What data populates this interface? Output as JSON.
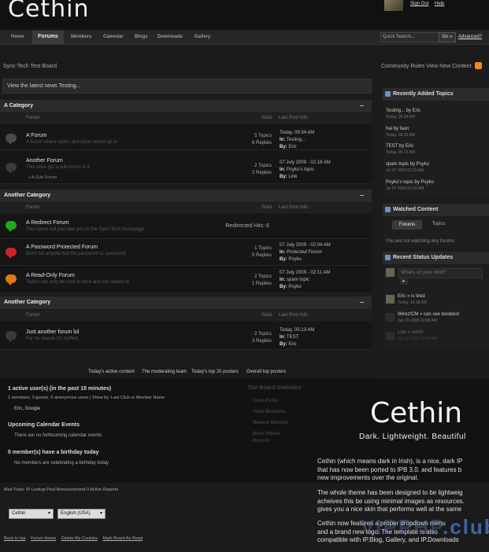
{
  "app": {
    "logo": "Cethin",
    "user_links": [
      "Sign Out",
      "Help"
    ]
  },
  "nav": {
    "tabs": [
      "Home",
      "Forums",
      "Members",
      "Calendar",
      "Blogs",
      "Downloads",
      "Gallery"
    ],
    "active": "Forums",
    "search_placeholder": "Quick Search...",
    "go_label": "Go »",
    "advanced_label": "Advanced?"
  },
  "breadcrumb": "Sync-Tech Test Board",
  "community_links": "Community Rules   View New Content",
  "news": "View the latest news Testing...",
  "columns": {
    "forum": "Forum",
    "stats": "Stats",
    "last_post": "Last Post Info"
  },
  "categories": [
    {
      "title": "A Category",
      "forums": [
        {
          "name": "A Forum",
          "desc": "A forum where topics and posts would go in.",
          "topics": "5 Topics",
          "replies": "6 Replies",
          "lp_date": "Today, 09:34 AM",
          "lp_in": "Testing...",
          "lp_by": "Eric",
          "icon_color": "#4a4a4a"
        },
        {
          "name": "Another Forum",
          "desc": "This ones got a sub-forum in it.",
          "topics": "2 Topics",
          "replies": "2 Replies",
          "lp_date": "07 July 2009 - 02:18 AM",
          "lp_in": "Psyko's topic",
          "lp_by": "Link",
          "icon_color": "#3a3a3a",
          "subforum": "» A Sub Forum"
        }
      ]
    },
    {
      "title": "Another Category",
      "forums": [
        {
          "name": "A Redirect Forum",
          "desc": "This forum will just take you to the Sync-Tech homepage",
          "redirect": "Redirected Hits: 6",
          "icon_color": "#1ea81e"
        },
        {
          "name": "A Password Protected Forum",
          "desc": "Don't tell anyone but the password is: password",
          "topics": "1 Topics",
          "replies": "5 Replies",
          "lp_date": "07 July 2009 - 02:04 AM",
          "lp_in": "Protected Forum",
          "lp_by": "Psyko",
          "icon_color": "#cf2222"
        },
        {
          "name": "A Read-Only Forum",
          "desc": "Topics can only be read in here and not replied to",
          "topics": "2 Topics",
          "replies": "1 Replies",
          "lp_date": "07 July 2009 - 02:11 AM",
          "lp_in": "spam topic",
          "lp_by": "Psyko",
          "icon_color": "#e07a12"
        }
      ]
    },
    {
      "title": "Another Category",
      "forums": [
        {
          "name": "Just another forum lol",
          "desc": "For no reason it's stuffed",
          "topics": "2 Topics",
          "replies": "3 Replies",
          "lp_date": "Today, 05:13 AM",
          "lp_in": "TEST",
          "lp_by": "Eric",
          "icon_color": "#3a3a3a"
        }
      ]
    }
  ],
  "labels": {
    "in": "In:",
    "by": "By:"
  },
  "sidebar": {
    "recent_title": "Recently Added Topics",
    "recent": [
      {
        "t": "Testing... by Eric",
        "d": "Today, 09:34 AM"
      },
      {
        "t": "hai by faun",
        "d": "Today, 09:15 AM"
      },
      {
        "t": "TEST by Eric",
        "d": "Today, 05:13 AM"
      },
      {
        "t": "spam topic by Psyko",
        "d": "Jul 07 2009 02:11 AM"
      },
      {
        "t": "Psyko's topic by Psyko",
        "d": "Jul 07 2009 02:18 AM"
      }
    ],
    "watched_title": "Watched Content",
    "watched_tabs": [
      "Forums",
      "Topics"
    ],
    "watched_msg": "You are not watching any forums",
    "status_title": "Recent Status Updates",
    "status_placeholder": "What's on your mind?",
    "statuses": [
      {
        "t": "Eric » is tired",
        "d": "Today, 10:18 AM"
      },
      {
        "t": "Wirez!CM » can see boobies!",
        "d": "Jun 25 2009 02:08 AM"
      },
      {
        "t": "Link » mmm",
        "d": "Jun 22 2009 02:04 AM"
      }
    ]
  },
  "stats": {
    "tabs": [
      "Today's active content",
      "The moderating team",
      "Today's top 20 posters",
      "Overall top posters"
    ],
    "active_title": "1 active user(s) (in the past 15 minutes)",
    "active_detail": "1 members, 0 guests, 0 anonymous users | Show by: Last Click or Member Name",
    "active_users": "Eric, Google",
    "calendar_title": "Upcoming Calendar Events",
    "calendar_msg": "There are no forthcoming calendar events",
    "birthday_title": "0 member(s) have a birthday today",
    "birthday_msg": "No members are celebrating a birthday today",
    "board_title": "Our Board Statistics",
    "board_items": [
      "Total Posts",
      "Total Members",
      "Newest Member",
      "Most Online",
      "Record"
    ]
  },
  "promo": {
    "logo": "Cethin",
    "tagline": "Dark. Lightweight. Beautiful",
    "p1": [
      "Cethin (which means dark in Irish), is a nice, dark IP",
      "that has now been ported to IPB 3.0. and features b",
      "new improvements over the original."
    ],
    "p2": [
      "The whole theme has been designed to be lightweig",
      "acheives this be using minimal images as resources.",
      "gives you a nice skin that performs well at the same"
    ],
    "p3": [
      "Cethin now features a proper dropdown menu",
      "and a brand new logo. The template is also",
      "compatible with IP.Blog, Gallery, and IP.Downloads"
    ],
    "watermark_a": "VIPPHP",
    "watermark_b": ".club"
  },
  "footer": {
    "modtools": "Mod Tools:  IP Lookup    Post Announcement    0 Active Reports",
    "skin_select": "Cethin",
    "lang_select": "English (USA)",
    "links": [
      "Back to top",
      "Forum Home",
      "Delete My Cookies",
      "Mark Board As Read"
    ]
  }
}
